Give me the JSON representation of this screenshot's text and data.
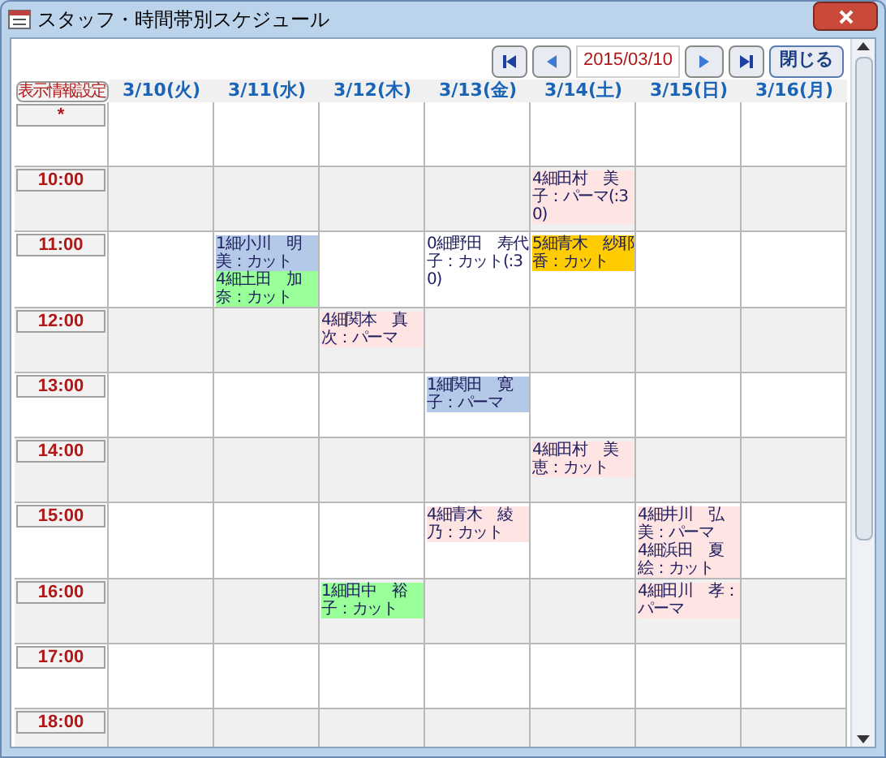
{
  "window": {
    "title": "スタッフ・時間帯別スケジュール"
  },
  "toolbar": {
    "date": "2015/03/10",
    "close_button": "閉じる"
  },
  "settings_button": "表示情報設定",
  "days": [
    "3/10(火)",
    "3/11(水)",
    "3/12(木)",
    "3/13(金)",
    "3/14(土)",
    "3/15(日)",
    "3/16(月)"
  ],
  "rows": [
    {
      "time": "*",
      "cells": [
        {},
        {},
        {},
        {},
        {},
        {},
        {}
      ]
    },
    {
      "time": "10:00",
      "cells": [
        {},
        {},
        {},
        {},
        {
          "entries": [
            {
              "text": "4細田村　美子：パーマ(:30)",
              "color": "#ffe4e4"
            }
          ]
        },
        {},
        {}
      ]
    },
    {
      "time": "11:00",
      "cells": [
        {},
        {
          "entries": [
            {
              "text": "1細小川　明美：カット",
              "color": "#b4c8e8"
            },
            {
              "text": "4細土田　加奈：カット",
              "color": "#99ff99"
            }
          ]
        },
        {},
        {
          "entries": [
            {
              "text": "0細野田　寿代子：カット(:30)",
              "color": "#ffffff"
            }
          ]
        },
        {
          "entries": [
            {
              "text": "5細青木　紗耶香：カット",
              "color": "#ffcc00"
            }
          ]
        },
        {},
        {}
      ]
    },
    {
      "time": "12:00",
      "cells": [
        {},
        {},
        {
          "entries": [
            {
              "text": "4細関本　真次：パーマ",
              "color": "#ffe4e4"
            }
          ]
        },
        {},
        {},
        {},
        {}
      ]
    },
    {
      "time": "13:00",
      "cells": [
        {},
        {},
        {},
        {
          "entries": [
            {
              "text": "1細関田　寛子：パーマ",
              "color": "#b4c8e8"
            }
          ]
        },
        {},
        {},
        {}
      ]
    },
    {
      "time": "14:00",
      "cells": [
        {},
        {},
        {},
        {},
        {
          "entries": [
            {
              "text": "4細田村　美恵：カット",
              "color": "#ffe4e4"
            }
          ]
        },
        {},
        {}
      ]
    },
    {
      "time": "15:00",
      "cells": [
        {},
        {},
        {},
        {
          "entries": [
            {
              "text": "4細青木　綾乃：カット",
              "color": "#ffe4e4"
            }
          ]
        },
        {},
        {
          "entries": [
            {
              "text": "4細井川　弘美：パーマ",
              "color": "#ffe4e4"
            },
            {
              "text": "4細浜田　夏絵：カット",
              "color": "#ffe4e4"
            }
          ]
        },
        {}
      ]
    },
    {
      "time": "16:00",
      "cells": [
        {},
        {},
        {
          "entries": [
            {
              "text": "1細田中　裕子：カット",
              "color": "#99ff99"
            }
          ]
        },
        {},
        {},
        {
          "entries": [
            {
              "text": "4細田川　孝：パーマ",
              "color": "#ffe4e4"
            }
          ]
        },
        {}
      ]
    },
    {
      "time": "17:00",
      "cells": [
        {},
        {},
        {},
        {},
        {},
        {},
        {}
      ]
    },
    {
      "time": "18:00",
      "cells": [
        {},
        {},
        {},
        {},
        {},
        {},
        {}
      ]
    }
  ]
}
